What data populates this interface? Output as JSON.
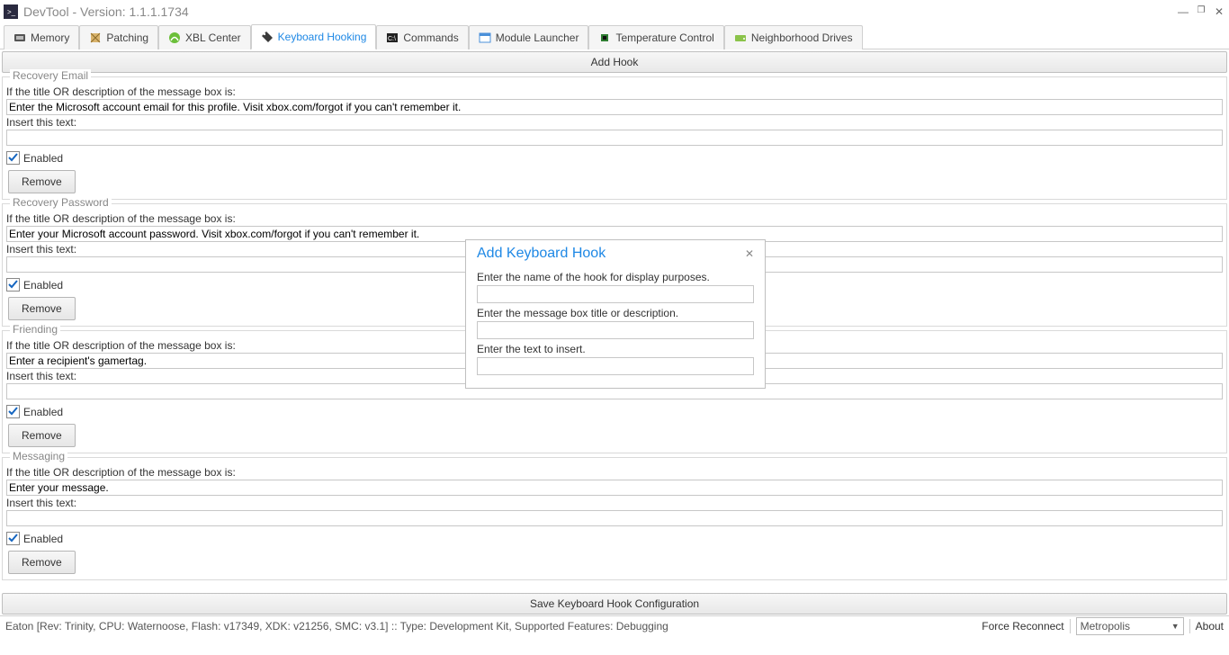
{
  "window": {
    "title": "DevTool - Version: 1.1.1.1734"
  },
  "tabs": [
    {
      "label": "Memory"
    },
    {
      "label": "Patching"
    },
    {
      "label": "XBL Center"
    },
    {
      "label": "Keyboard Hooking"
    },
    {
      "label": "Commands"
    },
    {
      "label": "Module Launcher"
    },
    {
      "label": "Temperature Control"
    },
    {
      "label": "Neighborhood Drives"
    }
  ],
  "addHookButton": "Add Hook",
  "labels": {
    "condition": "If the title OR description of the message box is:",
    "insert": "Insert this text:",
    "enabled": "Enabled",
    "remove": "Remove"
  },
  "hooks": [
    {
      "title": "Recovery Email",
      "match": "Enter the Microsoft account email for this profile. Visit xbox.com/forgot if you can't remember it.",
      "insert": "",
      "enabled": true
    },
    {
      "title": "Recovery Password",
      "match": "Enter your Microsoft account password. Visit xbox.com/forgot if you can't remember it.",
      "insert": "",
      "enabled": true
    },
    {
      "title": "Friending",
      "match": "Enter a recipient's gamertag.",
      "insert": "",
      "enabled": true
    },
    {
      "title": "Messaging",
      "match": "Enter your message.",
      "insert": "",
      "enabled": true
    }
  ],
  "saveButton": "Save Keyboard Hook Configuration",
  "dialog": {
    "title": "Add Keyboard Hook",
    "label1": "Enter the name of the hook for display purposes.",
    "label2": "Enter the message box title or description.",
    "label3": "Enter the text to insert."
  },
  "status": {
    "left": "Eaton [Rev: Trinity, CPU: Waternoose, Flash: v17349, XDK: v21256, SMC: v3.1] :: Type: Development Kit, Supported Features: Debugging",
    "forceReconnect": "Force Reconnect",
    "combo": "Metropolis",
    "about": "About"
  }
}
